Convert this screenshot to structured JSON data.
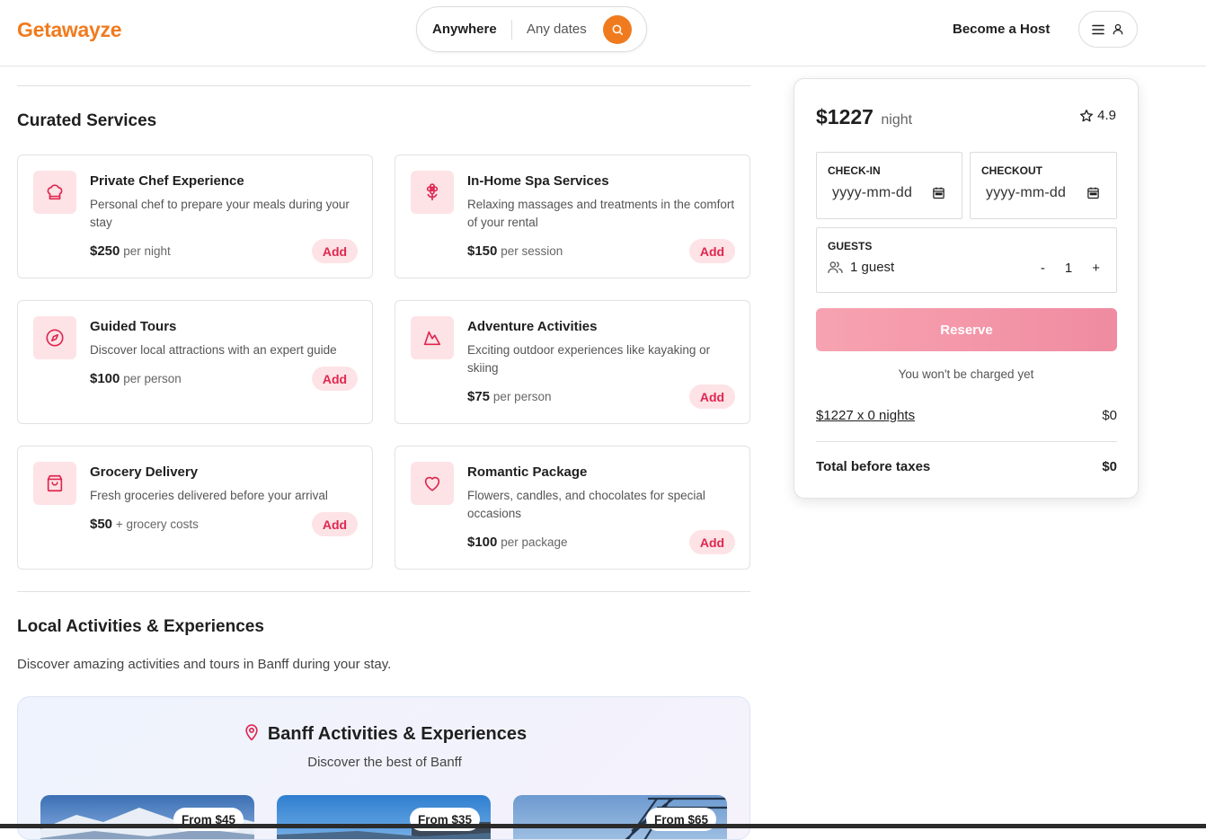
{
  "header": {
    "logo": "Getawayze",
    "search": {
      "location": "Anywhere",
      "dates": "Any dates",
      "icon": "search-icon"
    },
    "host_link": "Become a Host",
    "menu": {
      "icons": [
        "menu-icon",
        "user-icon"
      ]
    }
  },
  "colors": {
    "brand": "#f07b1f",
    "accent": "#e0264f",
    "accent_bg": "#fde3e6",
    "reserve": "#f49aae"
  },
  "curated": {
    "title": "Curated Services",
    "add_label": "Add",
    "services": [
      {
        "title": "Private Chef Experience",
        "desc": "Personal chef to prepare your meals during your stay",
        "price": "$250",
        "unit": "per night",
        "icon": "chef-hat-icon"
      },
      {
        "title": "In-Home Spa Services",
        "desc": "Relaxing massages and treatments in the comfort of your rental",
        "price": "$150",
        "unit": "per session",
        "icon": "flower-icon"
      },
      {
        "title": "Guided Tours",
        "desc": "Discover local attractions with an expert guide",
        "price": "$100",
        "unit": "per person",
        "icon": "compass-icon"
      },
      {
        "title": "Adventure Activities",
        "desc": "Exciting outdoor experiences like kayaking or skiing",
        "price": "$75",
        "unit": "per person",
        "icon": "mountain-icon"
      },
      {
        "title": "Grocery Delivery",
        "desc": "Fresh groceries delivered before your arrival",
        "price": "$50",
        "unit": "+ grocery costs",
        "icon": "shopping-bag-icon"
      },
      {
        "title": "Romantic Package",
        "desc": "Flowers, candles, and chocolates for special occasions",
        "price": "$100",
        "unit": "per package",
        "icon": "heart-icon"
      }
    ]
  },
  "local": {
    "title": "Local Activities & Experiences",
    "subtitle": "Discover amazing activities and tours in Banff during your stay.",
    "box_title": "Banff Activities & Experiences",
    "box_subtitle": "Discover the best of Banff",
    "activities": [
      {
        "price": "From $45"
      },
      {
        "price": "From $35"
      },
      {
        "price": "From $65"
      }
    ]
  },
  "booking": {
    "price": "$1227",
    "price_unit": "night",
    "rating": "4.9",
    "checkin_label": "CHECK-IN",
    "checkout_label": "CHECKOUT",
    "date_placeholder": "yyyy-mm-dd",
    "guests_label": "GUESTS",
    "guests_value": "1 guest",
    "stepper": {
      "minus": "-",
      "value": "1",
      "plus": "+"
    },
    "reserve_label": "Reserve",
    "note": "You won't be charged yet",
    "line_label": "$1227 x 0 nights",
    "line_value": "$0",
    "total_label": "Total before taxes",
    "total_value": "$0"
  }
}
